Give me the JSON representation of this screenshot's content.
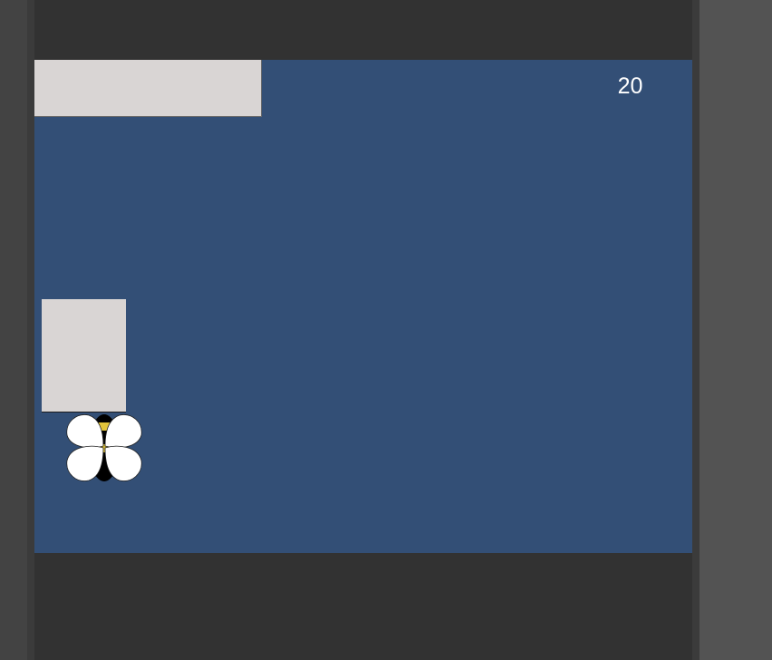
{
  "game": {
    "score": "20"
  },
  "colors": {
    "stage_background": "#334f76",
    "block": "#d9d5d4",
    "frame": "#323232",
    "score_text": "#ffffff",
    "bee_body": "#000000",
    "bee_stripe": "#e1c43b",
    "bee_wing": "#ffffff"
  },
  "sprites": {
    "player": "bee-icon",
    "obstacles": [
      "stone-block",
      "stone-block"
    ]
  }
}
